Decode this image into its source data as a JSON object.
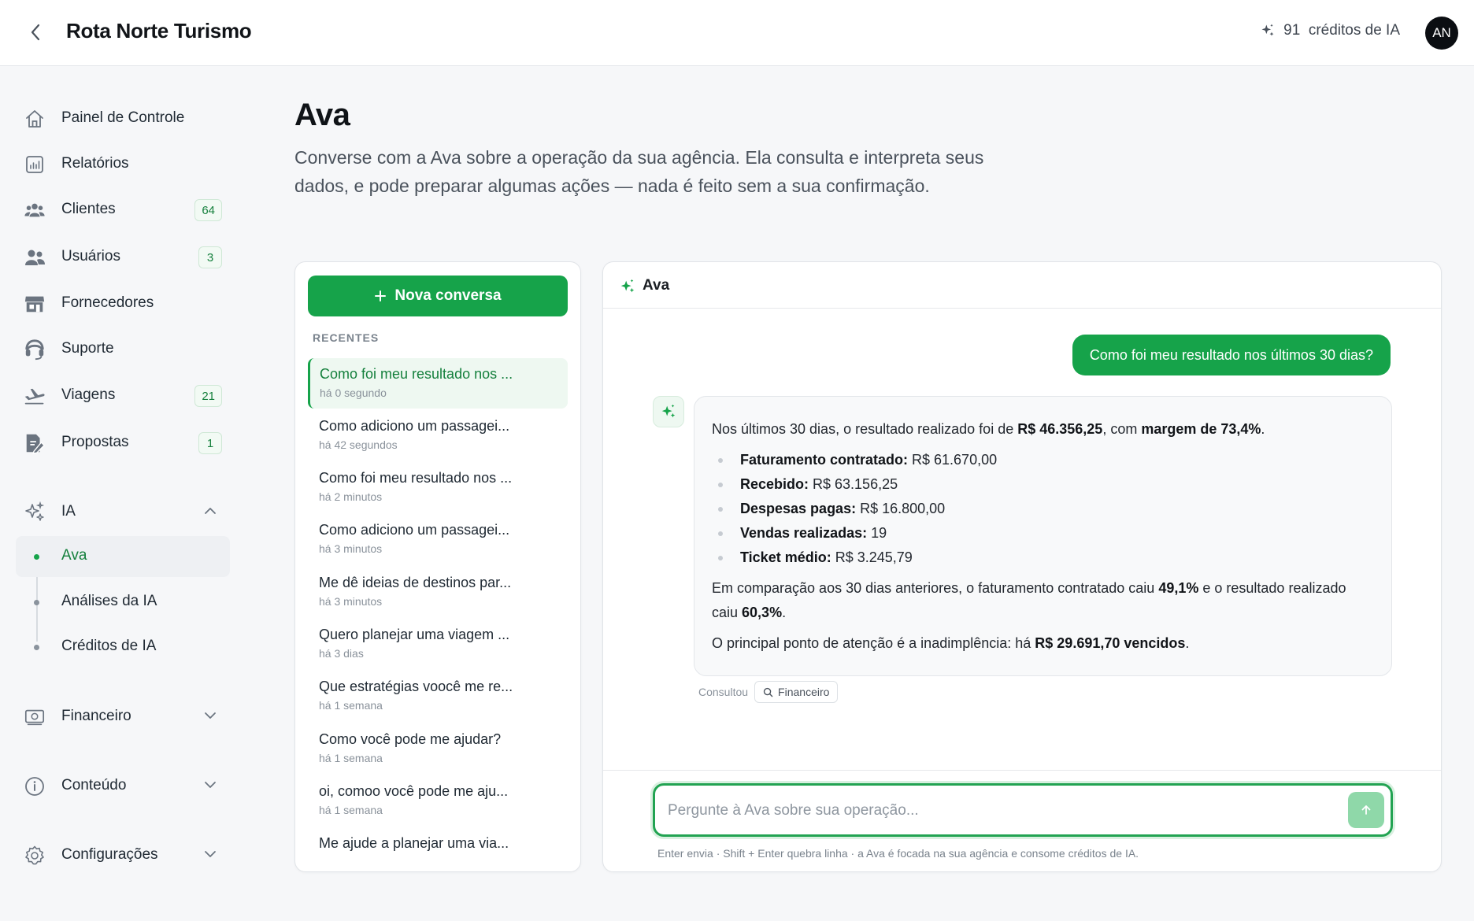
{
  "header": {
    "title": "Rota Norte Turismo",
    "credits": "91  créditos de IA",
    "avatar": "AN"
  },
  "sidebar": {
    "items": [
      {
        "label": "Painel de Controle",
        "icon": "home-icon"
      },
      {
        "label": "Relatórios",
        "icon": "chart-icon"
      },
      {
        "label": "Clientes",
        "icon": "clients-icon",
        "badge": "64"
      },
      {
        "label": "Usuários",
        "icon": "users-icon",
        "badge": "3"
      },
      {
        "label": "Fornecedores",
        "icon": "store-icon"
      },
      {
        "label": "Suporte",
        "icon": "headset-icon"
      },
      {
        "label": "Viagens",
        "icon": "plane-icon",
        "badge": "21"
      },
      {
        "label": "Propostas",
        "icon": "proposal-icon",
        "badge": "1"
      }
    ],
    "ia": {
      "label": "IA",
      "subitems": [
        {
          "label": "Ava",
          "active": true
        },
        {
          "label": "Análises da IA"
        },
        {
          "label": "Créditos de IA"
        }
      ]
    },
    "groups": [
      {
        "label": "Financeiro",
        "icon": "money-icon"
      },
      {
        "label": "Conteúdo",
        "icon": "info-icon"
      },
      {
        "label": "Configurações",
        "icon": "gear-icon"
      }
    ]
  },
  "main": {
    "title": "Ava",
    "description": "Converse com a Ava sobre a operação da sua agência. Ela consulta e interpreta seus dados, e pode preparar algumas ações — nada é feito sem a sua confirmação."
  },
  "conversations": {
    "new_label": "Nova conversa",
    "recent_heading": "RECENTES",
    "items": [
      {
        "title": "Como foi meu resultado nos ...",
        "time": "há 0 segundo",
        "active": true
      },
      {
        "title": "Como adiciono um passagei...",
        "time": "há 42 segundos"
      },
      {
        "title": "Como foi meu resultado nos ...",
        "time": "há 2 minutos"
      },
      {
        "title": "Como adiciono um passagei...",
        "time": "há 3 minutos"
      },
      {
        "title": "Me dê ideias de destinos par...",
        "time": "há 3 minutos"
      },
      {
        "title": "Quero planejar uma viagem ...",
        "time": "há 3 dias"
      },
      {
        "title": "Que estratégias voocê me re...",
        "time": "há 1 semana"
      },
      {
        "title": "Como você pode me ajudar?",
        "time": "há 1 semana"
      },
      {
        "title": "oi, comoo você pode me aju...",
        "time": "há 1 semana"
      },
      {
        "title": "Me ajude a planejar uma via...",
        "time": ""
      }
    ]
  },
  "chat": {
    "header": "Ava",
    "user_message": "Como foi meu resultado nos últimos 30 dias?",
    "reply": {
      "intro_a": "Nos últimos 30 dias, o resultado realizado foi de ",
      "intro_value": "R$ 46.356,25",
      "intro_b": ", com ",
      "intro_margin": "margem de 73,4%",
      "intro_c": ".",
      "bullets": [
        {
          "label": "Faturamento contratado:",
          "value": " R$ 61.670,00"
        },
        {
          "label": "Recebido:",
          "value": " R$ 63.156,25"
        },
        {
          "label": "Despesas pagas:",
          "value": " R$ 16.800,00"
        },
        {
          "label": "Vendas realizadas:",
          "value": " 19"
        },
        {
          "label": "Ticket médio:",
          "value": " R$ 3.245,79"
        }
      ],
      "comp_a": "Em comparação aos 30 dias anteriores, o faturamento contratado caiu ",
      "comp_v1": "49,1%",
      "comp_b": " e o resultado realizado caiu ",
      "comp_v2": "60,3%",
      "comp_c": ".",
      "attn_a": "O principal ponto de atenção é a inadimplência: há ",
      "attn_v": "R$ 29.691,70 vencidos",
      "attn_c": "."
    },
    "consulted_label": "Consultou",
    "consulted_chip": "Financeiro",
    "input_placeholder": "Pergunte à Ava sobre sua operação...",
    "hint": "Enter envia · Shift + Enter quebra linha · a Ava é focada na sua agência e consome créditos de IA."
  },
  "colors": {
    "accent": "#16a34a",
    "accent_light": "#eef8f1",
    "send_disabled": "#8fd8a9"
  }
}
